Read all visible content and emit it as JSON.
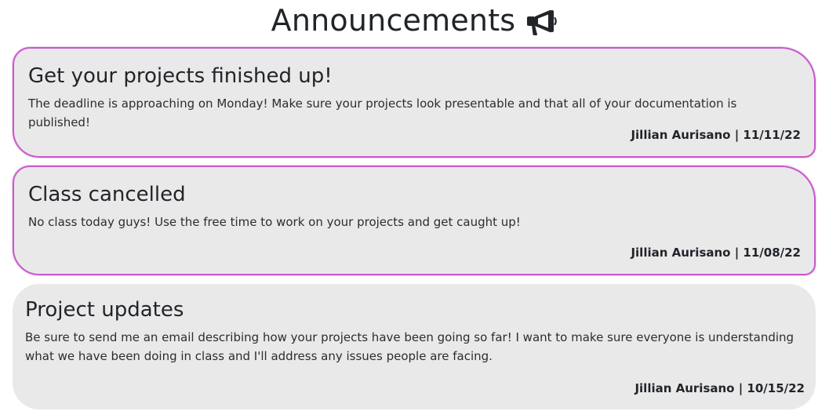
{
  "header": {
    "title": "Announcements",
    "icon": "megaphone-icon"
  },
  "announcements": [
    {
      "title": "Get your projects finished up!",
      "body": "The deadline is approaching on Monday! Make sure your projects look presentable and that all of your documentation is published!",
      "footer": "Jillian Aurisano | 11/11/22"
    },
    {
      "title": "Class cancelled",
      "body": "No class today guys! Use the free time to work on your projects and get caught up!",
      "footer": "Jillian Aurisano | 11/08/22"
    },
    {
      "title": "Project updates",
      "body": "Be sure to send me an email describing how your projects have been going so far! I want to make sure everyone is understanding what we have been doing in class and I'll address any issues people are facing.",
      "footer": "Jillian Aurisano | 10/15/22"
    }
  ],
  "colors": {
    "card_background": "#e9e9ea",
    "highlight_border": "#c95acb",
    "text": "#212529"
  }
}
